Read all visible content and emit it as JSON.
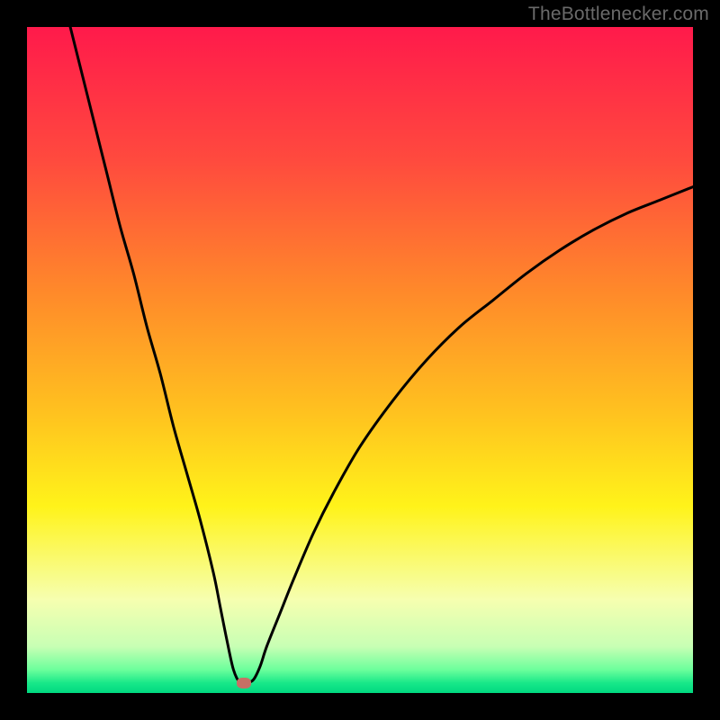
{
  "watermark": "TheBottlenecker.com",
  "chart_data": {
    "type": "line",
    "title": "",
    "xlabel": "",
    "ylabel": "",
    "xlim": [
      0,
      100
    ],
    "ylim": [
      0,
      100
    ],
    "x": [
      6.5,
      8,
      10,
      12,
      14,
      16,
      18,
      20,
      22,
      24,
      26,
      28,
      29,
      30,
      31,
      32,
      33,
      34,
      35,
      36,
      38,
      40,
      43,
      46,
      50,
      55,
      60,
      65,
      70,
      75,
      80,
      85,
      90,
      95,
      100
    ],
    "values": [
      100,
      94,
      86,
      78,
      70,
      63,
      55,
      48,
      40,
      33,
      26,
      18,
      13,
      8,
      3.5,
      1.5,
      1.5,
      2,
      4,
      7,
      12,
      17,
      24,
      30,
      37,
      44,
      50,
      55,
      59,
      63,
      66.5,
      69.5,
      72,
      74,
      76
    ],
    "marker": {
      "x": 32.5,
      "y": 1.5
    },
    "gradient_stops": [
      {
        "offset": 0,
        "color": "#ff1a4b"
      },
      {
        "offset": 0.2,
        "color": "#ff4a3e"
      },
      {
        "offset": 0.4,
        "color": "#ff8a2a"
      },
      {
        "offset": 0.58,
        "color": "#ffc21f"
      },
      {
        "offset": 0.72,
        "color": "#fff31a"
      },
      {
        "offset": 0.86,
        "color": "#f6ffb0"
      },
      {
        "offset": 0.93,
        "color": "#c8ffb4"
      },
      {
        "offset": 0.965,
        "color": "#6cff9c"
      },
      {
        "offset": 0.985,
        "color": "#18e889"
      },
      {
        "offset": 1.0,
        "color": "#00d980"
      }
    ]
  }
}
